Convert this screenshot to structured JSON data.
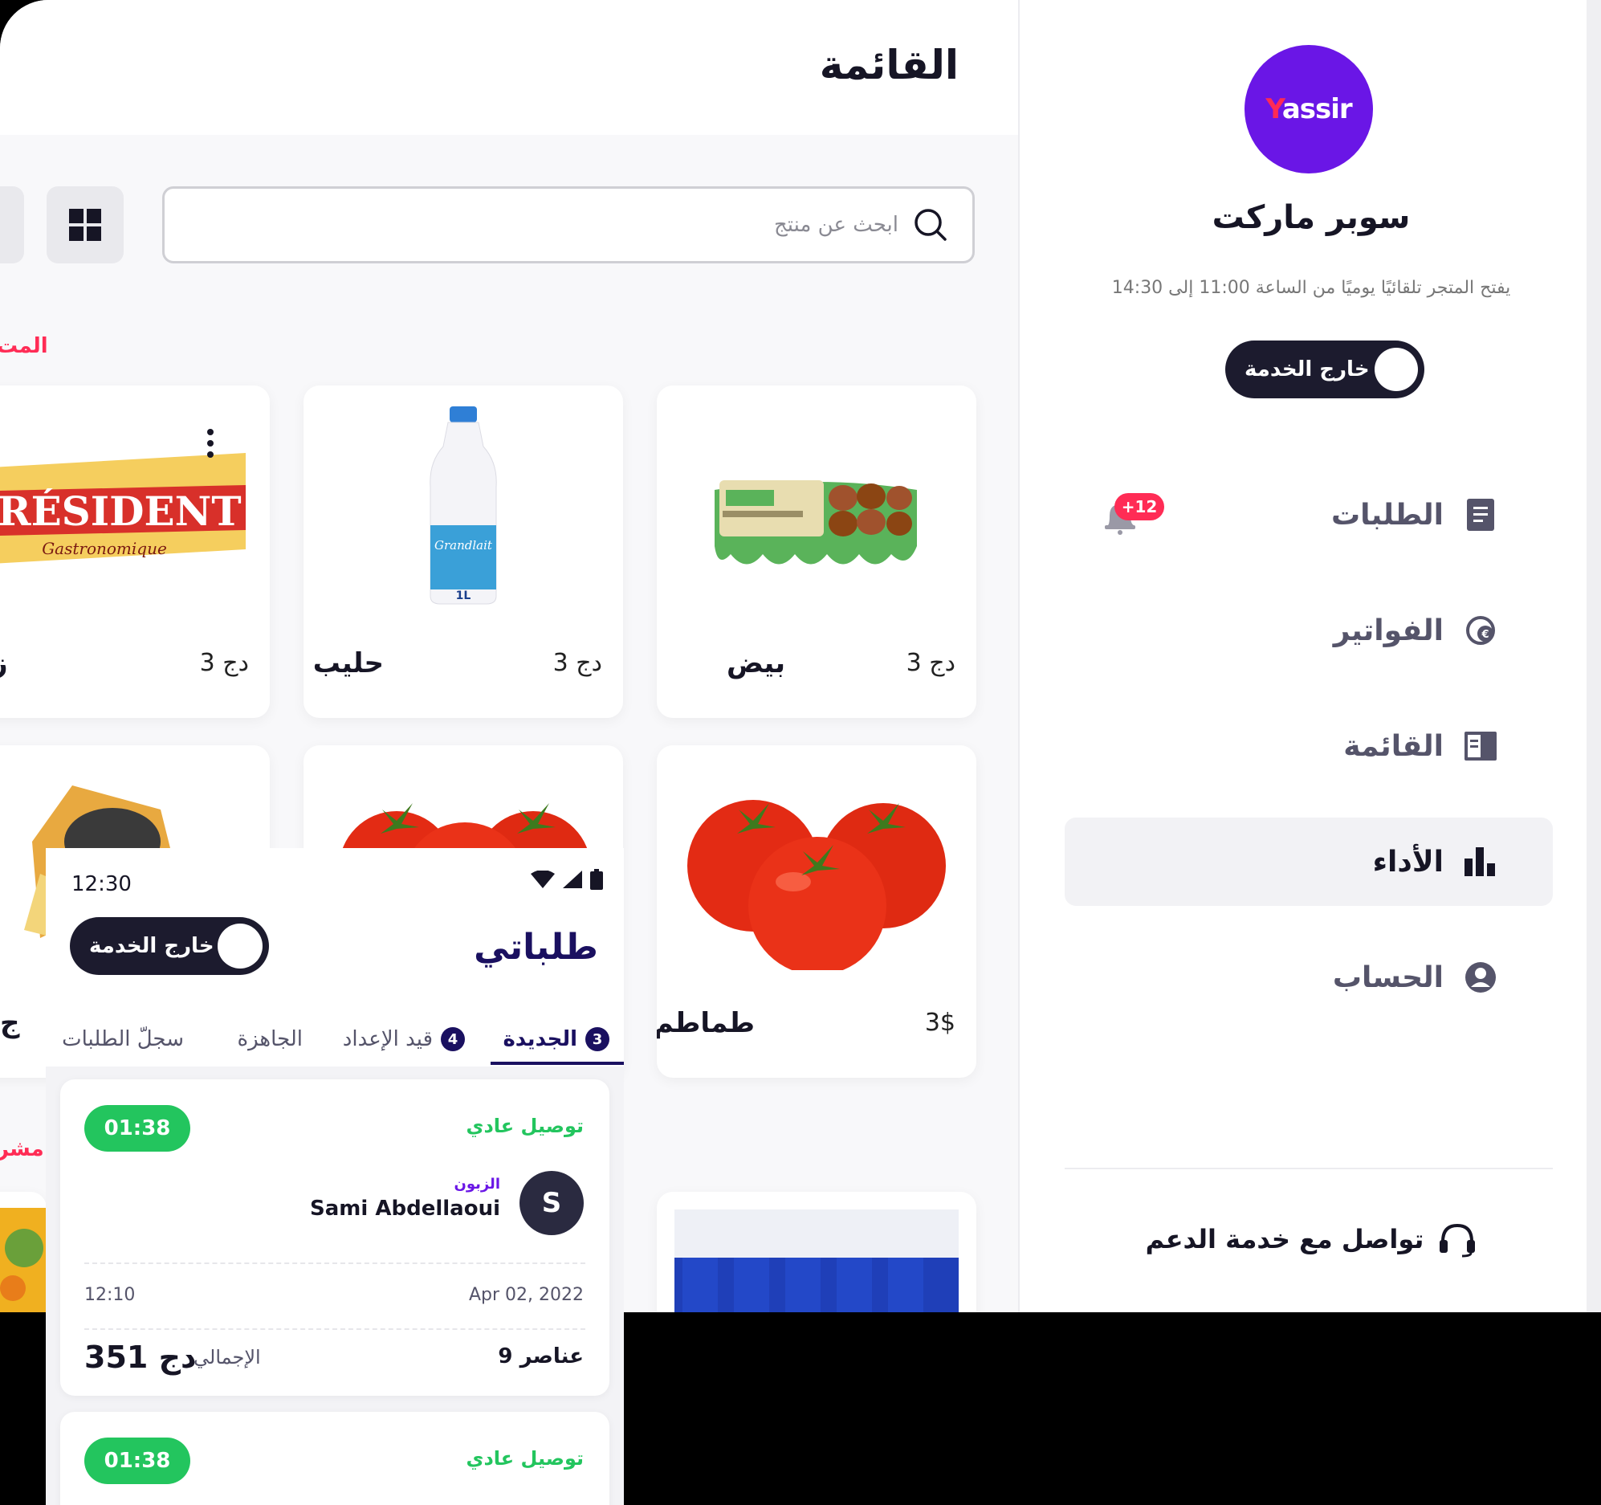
{
  "sidebar": {
    "logo_text_x": "Y",
    "logo_text_rest": "assir",
    "store_name": "سوبر ماركت",
    "store_hours": "يفتح المتجر تلقائيًا يوميًا من الساعة 11:00 إلى 14:30",
    "toggle_label": "خارج الخدمة",
    "orders_badge": "+12",
    "nav": {
      "orders": "الطلبات",
      "invoices": "الفواتير",
      "menu": "القائمة",
      "performance": "الأداء",
      "account": "الحساب"
    },
    "support": "تواصل مع خدمة الدعم"
  },
  "main": {
    "title": "القائمة",
    "search_placeholder": "ابحث عن منتج",
    "section_cut_1": "المت",
    "section_cut_2": "مشر",
    "products": [
      {
        "name": "بيض",
        "price": "3 دج"
      },
      {
        "name": "حليب",
        "price": "3 دج"
      },
      {
        "name": "ز",
        "price": "3 دج"
      },
      {
        "name": "طماطم",
        "price": "3$"
      },
      {
        "name": "ج",
        "price": ""
      }
    ],
    "president_brand": "PRÉSIDENT",
    "president_sub": "Gastronomique",
    "milk_brand": "Grandlait",
    "milk_volume": "1L"
  },
  "phone": {
    "time": "12:30",
    "title": "طلباتي",
    "toggle_label": "خارج الخدمة",
    "tabs": {
      "new": "الجديدة",
      "new_count": "3",
      "preparing": "قيد الإعداد",
      "preparing_count": "4",
      "ready": "الجاهزة",
      "history": "سجلّ الطلبات"
    },
    "orders": [
      {
        "timer": "01:38",
        "delivery": "توصيل عادي",
        "customer_label": "الزبون",
        "customer_name": "Sami Abdellaoui",
        "avatar": "S",
        "date": "Apr 02, 2022",
        "time": "12:10",
        "items": "9 عناصر",
        "total_label": "الإجمالي",
        "total": "351 دج"
      },
      {
        "timer": "01:38",
        "delivery": "توصيل عادي"
      }
    ]
  },
  "colors": {
    "brand_purple": "#6a16e6",
    "brand_red": "#ff2c55",
    "dark_navy": "#1c1b2e",
    "success_green": "#23c55e"
  }
}
